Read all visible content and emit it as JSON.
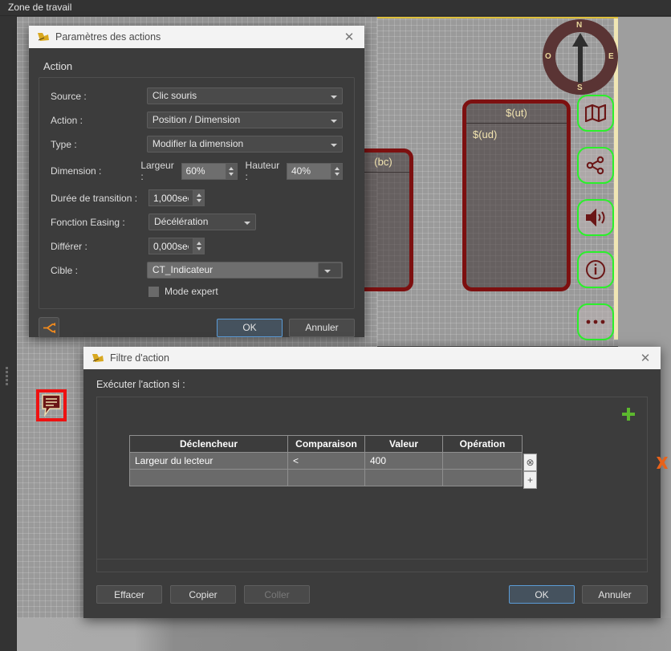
{
  "workspace": {
    "title": "Zone de travail",
    "compass": {
      "north": "N",
      "south": "S",
      "west": "O",
      "east": "E"
    },
    "panel_front": {
      "title": "$(ut)",
      "body": "$(ud)"
    },
    "panel_back": {
      "body": "(bc)"
    },
    "icons": [
      {
        "name": "map-icon"
      },
      {
        "name": "share-icon"
      },
      {
        "name": "volume-icon"
      },
      {
        "name": "info-icon"
      },
      {
        "name": "more-icon"
      }
    ]
  },
  "actions_dialog": {
    "title": "Paramètres des actions",
    "close": "✕",
    "group_label": "Action",
    "fields": {
      "source_label": "Source :",
      "source_value": "Clic souris",
      "action_label": "Action :",
      "action_value": "Position / Dimension",
      "type_label": "Type :",
      "type_value": "Modifier la dimension",
      "dimension_label": "Dimension :",
      "width_label": "Largeur :",
      "width_value": "60%",
      "height_label": "Hauteur :",
      "height_value": "40%",
      "transition_label": "Durée de transition :",
      "transition_value": "1,000sec",
      "easing_label": "Fonction Easing :",
      "easing_value": "Décélération",
      "defer_label": "Différer :",
      "defer_value": "0,000sec",
      "target_label": "Cible :",
      "target_value": "CT_Indicateur",
      "expert_label": "Mode expert"
    },
    "footer": {
      "ok": "OK",
      "cancel": "Annuler"
    }
  },
  "filter_dialog": {
    "title": "Filtre d'action",
    "close": "✕",
    "sub_label": "Exécuter l'action si :",
    "table": {
      "headers": [
        "Déclencheur",
        "Comparaison",
        "Valeur",
        "Opération"
      ],
      "rows": [
        [
          "Largeur du lecteur",
          "<",
          "400",
          ""
        ],
        [
          "",
          "",
          "",
          ""
        ]
      ]
    },
    "row_buttons": {
      "clear": "⊗",
      "add": "+"
    },
    "footer": {
      "clear": "Effacer",
      "copy": "Copier",
      "paste": "Coller",
      "ok": "OK",
      "cancel": "Annuler"
    }
  },
  "colors": {
    "accent_blue": "#5b9bd5",
    "accent_orange": "#e8621a",
    "accent_green": "#2bf02b",
    "panel_border_red": "#7d1010",
    "panel_text": "#f2e4b0"
  }
}
